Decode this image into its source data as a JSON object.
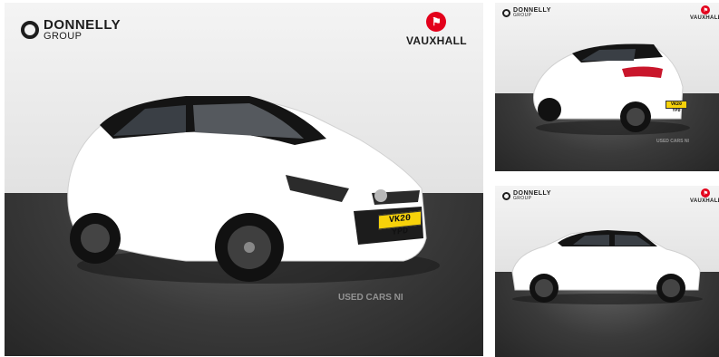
{
  "gallery": {
    "dealer_name": "DONNELLY",
    "dealer_sub": "GROUP",
    "maker": "VAUXHALL",
    "plate": "VK20 YPD",
    "watermark": "USED CARS NI",
    "colors": {
      "body": "#ffffff",
      "roof": "#111111",
      "brand_red": "#e3001b"
    },
    "images": [
      {
        "view": "front-three-quarter",
        "alt": "main-photo"
      },
      {
        "view": "rear-three-quarter",
        "alt": "thumbnail-1"
      },
      {
        "view": "side-profile",
        "alt": "thumbnail-2"
      }
    ]
  }
}
